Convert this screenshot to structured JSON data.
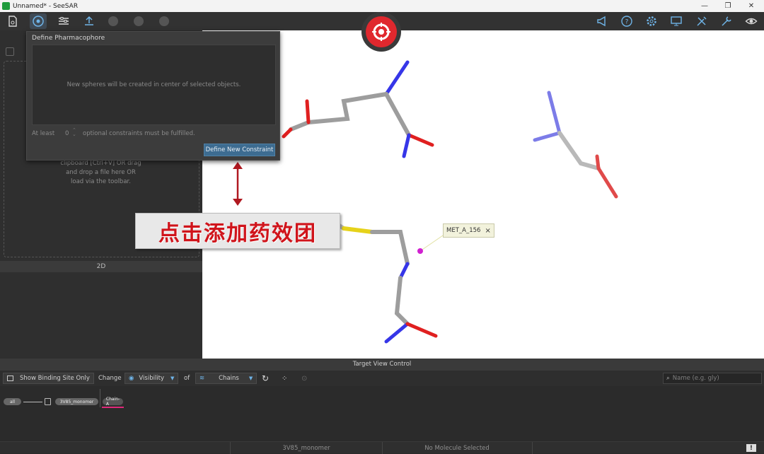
{
  "window": {
    "title": "Unnamed* - SeeSAR"
  },
  "popup": {
    "title": "Define Pharmacophore",
    "hint": "New spheres will be created in center of selected objects.",
    "at_least": "At least",
    "spin_value": "0",
    "optional": "optional constraints must be fulfilled.",
    "define_button": "Define New Constraint"
  },
  "left_panel": {
    "drop_text_1": "clipboard [Ctrl+V] OR drag",
    "drop_text_2": "and drop a file here OR",
    "drop_text_3": "load via the toolbar.",
    "tab_label": "2D"
  },
  "annotation": {
    "callout": "点击添加药效团"
  },
  "viewport": {
    "residue_tag": "MET_A_156",
    "tag_close": "×"
  },
  "target_view": {
    "header": "Target View Control",
    "show_binding_site": "Show Binding Site Only",
    "change": "Change",
    "visibility": "Visibility",
    "of": "of",
    "chains": "Chains",
    "search_placeholder": "Name (e.g. gly)"
  },
  "tree": {
    "all": "all",
    "monomer": "3V85_monomer",
    "chain": "Chain-A"
  },
  "status": {
    "structure": "3V85_monomer",
    "selection": "No Molecule Selected"
  },
  "colors": {
    "accent": "#e0282e",
    "button": "#3d6c91",
    "callout_text": "#d0141b"
  }
}
